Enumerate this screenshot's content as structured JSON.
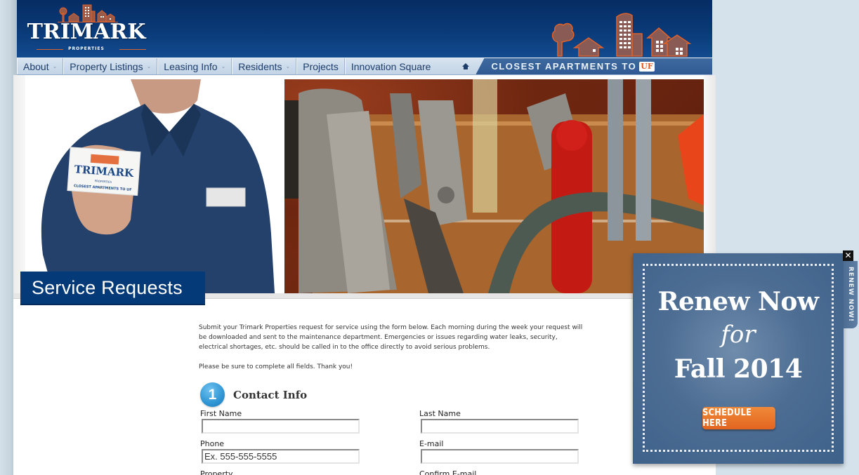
{
  "brand": {
    "name": "TRIMARK",
    "subtitle": "PROPERTIES",
    "colors": {
      "header_blue": "#0a3a78",
      "accent_orange": "#e2581f",
      "title_box": "#053a78"
    }
  },
  "nav": {
    "items": [
      {
        "label": "About",
        "has_dropdown": true,
        "caret": "⌄"
      },
      {
        "label": "Property Listings",
        "has_dropdown": true,
        "caret": "⌄"
      },
      {
        "label": "Leasing Info",
        "has_dropdown": true,
        "caret": "⌄"
      },
      {
        "label": "Residents",
        "has_dropdown": true,
        "caret": "⌄"
      },
      {
        "label": "Projects",
        "has_dropdown": false
      },
      {
        "label": "Innovation Square",
        "has_dropdown": false
      }
    ],
    "home_icon": "home-icon",
    "tagline": "CLOSEST APARTMENTS TO",
    "tagline_badge": "UF"
  },
  "hero": {
    "card_brand": "TRIMARK",
    "card_sub": "PROPERTIES",
    "card_tagline": "CLOSEST APARTMENTS TO UF"
  },
  "page": {
    "title": "Service Requests",
    "intro": [
      "Submit your Trimark Properties request for service using the form below. Each morning during the week your request will be downloaded and sent to the maintenance department. Emergencies or issues regarding water leaks, security, electrical shortages, etc. should be called in to the office directly to avoid serious problems.",
      "Please be sure to complete all fields. Thank you!"
    ]
  },
  "form": {
    "section": {
      "number": "1",
      "title": "Contact Info"
    },
    "fields": {
      "first_name": {
        "label": "First Name",
        "value": "",
        "placeholder": ""
      },
      "last_name": {
        "label": "Last Name",
        "value": "",
        "placeholder": ""
      },
      "phone": {
        "label": "Phone",
        "value": "",
        "placeholder": "Ex. 555-555-5555"
      },
      "email": {
        "label": "E-mail",
        "value": "",
        "placeholder": ""
      },
      "property": {
        "label": "Property"
      },
      "confirm_email": {
        "label": "Confirm E-mail"
      }
    }
  },
  "promo": {
    "line1": "Renew Now",
    "line2": "for",
    "line3": "Fall 2014",
    "button": "SCHEDULE HERE",
    "side_tab": "RENEW NOW!",
    "close": "✕"
  }
}
